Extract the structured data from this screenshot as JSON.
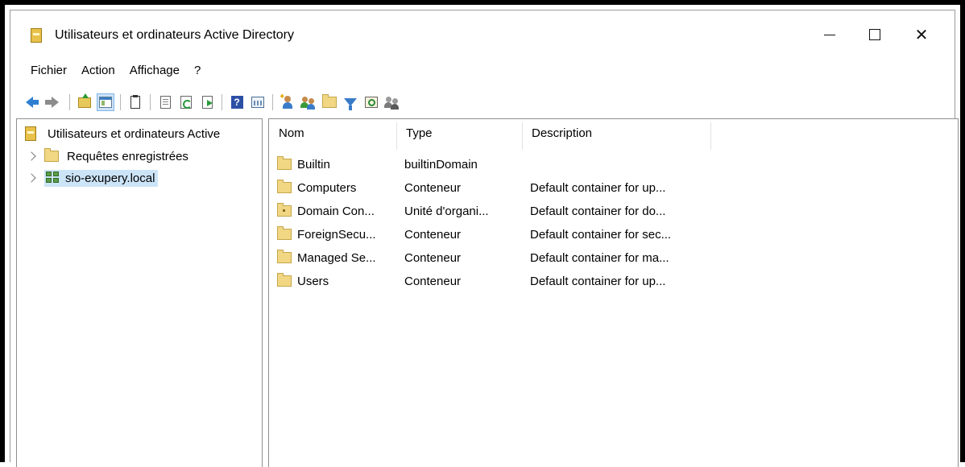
{
  "window": {
    "title": "Utilisateurs et ordinateurs Active Directory",
    "icon": "ad-console-icon",
    "controls": {
      "minimize": "–",
      "maximize": "☐",
      "close": "✕"
    }
  },
  "menu": [
    "Fichier",
    "Action",
    "Affichage",
    "?"
  ],
  "toolbar": [
    "back-icon",
    "forward-icon",
    "up-folder-icon",
    "show-console-tree-icon",
    "clipboard-icon",
    "export-list-icon",
    "refresh-icon",
    "export-icon",
    "help-icon",
    "properties-icon",
    "new-user-icon",
    "new-group-icon",
    "new-ou-icon",
    "filter-icon",
    "find-icon",
    "move-icon"
  ],
  "tree": {
    "root": "Utilisateurs et ordinateurs Active",
    "items": [
      {
        "label": "Requêtes enregistrées",
        "icon": "folder-icon"
      },
      {
        "label": "sio-exupery.local",
        "icon": "domain-icon",
        "selected": true
      }
    ]
  },
  "list": {
    "columns": [
      "Nom",
      "Type",
      "Description"
    ],
    "rows": [
      {
        "name": "Builtin",
        "type": "builtinDomain",
        "description": "",
        "icon": "folder-icon"
      },
      {
        "name": "Computers",
        "type": "Conteneur",
        "description": "Default container for up...",
        "icon": "folder-icon"
      },
      {
        "name": "Domain Con...",
        "type": "Unité d'organi...",
        "description": "Default container for do...",
        "icon": "ou-icon"
      },
      {
        "name": "ForeignSecu...",
        "type": "Conteneur",
        "description": "Default container for sec...",
        "icon": "folder-icon"
      },
      {
        "name": "Managed Se...",
        "type": "Conteneur",
        "description": "Default container for ma...",
        "icon": "folder-icon"
      },
      {
        "name": "Users",
        "type": "Conteneur",
        "description": "Default container for up...",
        "icon": "folder-icon"
      }
    ]
  },
  "colors": {
    "selection": "#cce4f7",
    "folder": "#f1d784",
    "frame": "#000000"
  }
}
